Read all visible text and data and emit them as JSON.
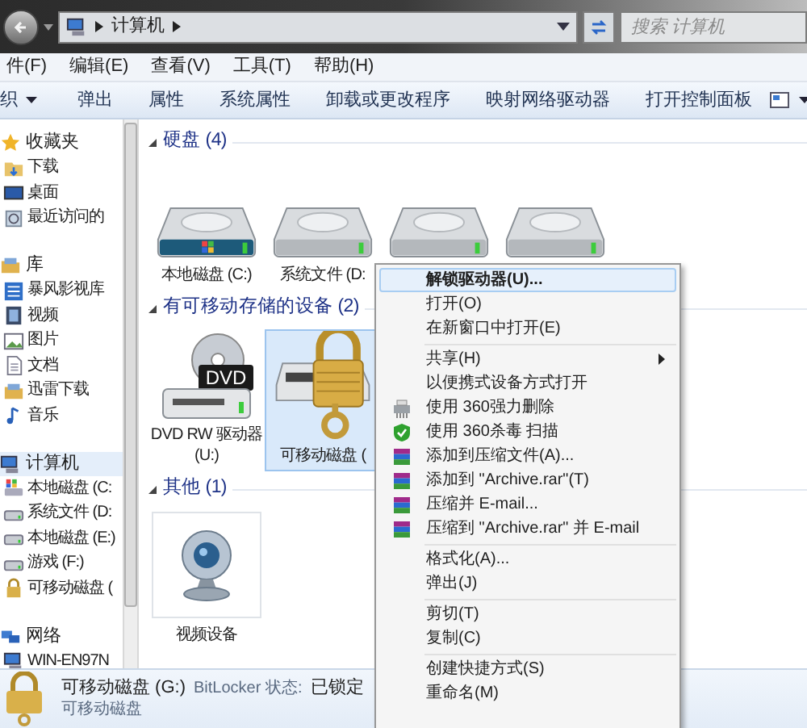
{
  "address_bar": {
    "path": [
      "计算机"
    ]
  },
  "search": {
    "placeholder": "搜索 计算机"
  },
  "menu_bar": [
    "件(F)",
    "编辑(E)",
    "查看(V)",
    "工具(T)",
    "帮助(H)"
  ],
  "toolbar": [
    {
      "label": "织",
      "dropdown": true
    },
    {
      "label": "弹出",
      "dropdown": false
    },
    {
      "label": "属性",
      "dropdown": false
    },
    {
      "label": "系统属性",
      "dropdown": false
    },
    {
      "label": "卸载或更改程序",
      "dropdown": false
    },
    {
      "label": "映射网络驱动器",
      "dropdown": false
    },
    {
      "label": "打开控制面板",
      "dropdown": false
    }
  ],
  "nav": [
    {
      "label": "收藏夹",
      "kind": "star",
      "children": [
        {
          "label": "下载",
          "kind": "folder"
        },
        {
          "label": "桌面",
          "kind": "desktop"
        },
        {
          "label": "最近访问的",
          "kind": "recent"
        }
      ]
    },
    {
      "label": "库",
      "kind": "library",
      "children": [
        {
          "label": "暴风影视库",
          "kind": "list"
        },
        {
          "label": "视频",
          "kind": "video"
        },
        {
          "label": "图片",
          "kind": "picture"
        },
        {
          "label": "文档",
          "kind": "document"
        },
        {
          "label": "迅雷下载",
          "kind": "library"
        },
        {
          "label": "音乐",
          "kind": "music"
        }
      ]
    },
    {
      "label": "计算机",
      "kind": "computer",
      "selected": true,
      "children": [
        {
          "label": "本地磁盘 (C:",
          "kind": "windrive"
        },
        {
          "label": "系统文件 (D:",
          "kind": "drive"
        },
        {
          "label": "本地磁盘 (E:)",
          "kind": "drive"
        },
        {
          "label": "游戏 (F:)",
          "kind": "drive"
        },
        {
          "label": "可移动磁盘 (",
          "kind": "lockdrive"
        }
      ]
    },
    {
      "label": "网络",
      "kind": "network",
      "children": [
        {
          "label": "WIN-EN97N",
          "kind": "computer"
        }
      ]
    }
  ],
  "groups": [
    {
      "title": "硬盘 (4)",
      "items": [
        {
          "label": "本地磁盘 (C:)",
          "kind": "windrive",
          "selected": false
        },
        {
          "label": "系统文件 (D:",
          "kind": "drive",
          "selected": false
        },
        {
          "kind": "drive",
          "selected": false
        },
        {
          "kind": "drive",
          "selected": false
        }
      ]
    },
    {
      "title": "有可移动存储的设备 (2)",
      "items": [
        {
          "label": "DVD RW 驱动器 (U:)",
          "kind": "dvd",
          "disc_label": "DVD",
          "selected": false
        },
        {
          "label": "可移动磁盘 (",
          "kind": "lockdrive",
          "selected": true
        }
      ]
    },
    {
      "title": "其他 (1)",
      "items": [
        {
          "label": "视频设备",
          "kind": "webcam",
          "selected": false
        }
      ]
    }
  ],
  "details": {
    "title": "可移动磁盘 (G:)",
    "field_label": "BitLocker 状态:",
    "field_value": "已锁定",
    "subtitle": "可移动磁盘"
  },
  "context_menu": [
    {
      "kind": "plain",
      "label": "解锁驱动器(U)...",
      "selected": true,
      "default": true
    },
    {
      "kind": "plain",
      "label": "打开(O)",
      "selected": false,
      "default": false
    },
    {
      "kind": "plain",
      "label": "在新窗口中打开(E)",
      "selected": false,
      "default": false
    },
    {
      "kind": "separator"
    },
    {
      "kind": "plain",
      "label": "共享(H)",
      "selected": false,
      "default": false,
      "submenu": true
    },
    {
      "kind": "plain",
      "label": "以便携式设备方式打开",
      "selected": false,
      "default": false
    },
    {
      "kind": "shredder",
      "label": "使用 360强力删除",
      "selected": false,
      "default": false
    },
    {
      "kind": "shield",
      "label": "使用 360杀毒 扫描",
      "selected": false,
      "default": false
    },
    {
      "kind": "archive",
      "label": "添加到压缩文件(A)...",
      "selected": false,
      "default": false
    },
    {
      "kind": "archive",
      "label": "添加到 \"Archive.rar\"(T)",
      "selected": false,
      "default": false
    },
    {
      "kind": "archive",
      "label": "压缩并 E-mail...",
      "selected": false,
      "default": false
    },
    {
      "kind": "archive",
      "label": "压缩到 \"Archive.rar\" 并 E-mail",
      "selected": false,
      "default": false
    },
    {
      "kind": "separator"
    },
    {
      "kind": "plain",
      "label": "格式化(A)...",
      "selected": false,
      "default": false
    },
    {
      "kind": "plain",
      "label": "弹出(J)",
      "selected": false,
      "default": false
    },
    {
      "kind": "separator"
    },
    {
      "kind": "plain",
      "label": "剪切(T)",
      "selected": false,
      "default": false
    },
    {
      "kind": "plain",
      "label": "复制(C)",
      "selected": false,
      "default": false
    },
    {
      "kind": "separator"
    },
    {
      "kind": "plain",
      "label": "创建快捷方式(S)",
      "selected": false,
      "default": false
    },
    {
      "kind": "plain",
      "label": "重命名(M)",
      "selected": false,
      "default": false
    }
  ]
}
